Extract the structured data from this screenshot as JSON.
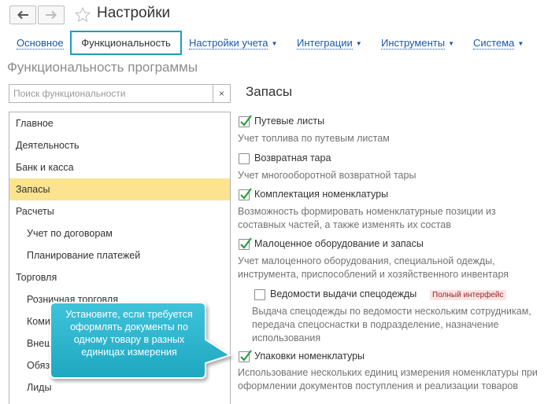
{
  "window": {
    "title": "Настройки"
  },
  "tabs": [
    {
      "label": "Основное",
      "dropdown": false
    },
    {
      "label": "Функциональность",
      "dropdown": false
    },
    {
      "label": "Настройки учета",
      "dropdown": true
    },
    {
      "label": "Интеграции",
      "dropdown": true
    },
    {
      "label": "Инструменты",
      "dropdown": true
    },
    {
      "label": "Система",
      "dropdown": true
    }
  ],
  "section_title": "Функциональность программы",
  "search": {
    "placeholder": "Поиск функциональности",
    "clear_icon": "×"
  },
  "left_list": [
    {
      "label": "Главное",
      "level": 0
    },
    {
      "label": "Деятельность",
      "level": 0
    },
    {
      "label": "Банк и касса",
      "level": 0
    },
    {
      "label": "Запасы",
      "level": 0,
      "selected": true
    },
    {
      "label": "Расчеты",
      "level": 0
    },
    {
      "label": "Учет по договорам",
      "level": 1
    },
    {
      "label": "Планирование платежей",
      "level": 1
    },
    {
      "label": "Торговля",
      "level": 0
    },
    {
      "label": "Розничная торговля",
      "level": 1
    },
    {
      "label": "Комис",
      "level": 1
    },
    {
      "label": "Внеш",
      "level": 1
    },
    {
      "label": "Обяза",
      "level": 1
    },
    {
      "label": "Лиды",
      "level": 1
    }
  ],
  "right_panel": {
    "title": "Запасы",
    "options": [
      {
        "label": "Путевые листы",
        "checked": true,
        "description": "Учет топлива по путевым листам"
      },
      {
        "label": "Возвратная тара",
        "checked": false,
        "description": "Учет многооборотной возвратной тары"
      },
      {
        "label": "Комплектация номенклатуры",
        "checked": true,
        "description": "Возможность формировать номенклатурные позиции из составных частей, а также изменять их состав"
      },
      {
        "label": "Малоценное оборудование и запасы",
        "checked": true,
        "description": "Учет малоценного оборудования, специальной одежды, инструмента, приспособлений и хозяйственного инвентаря"
      },
      {
        "label": "Ведомости выдачи спецодежды",
        "checked": false,
        "badge": "Полный интерфейс",
        "description": "Выдача спецодежды по ведомости нескольким сотрудникам, передача спецоснастки в подразделение, назначение использования"
      },
      {
        "label": "Упаковки номенклатуры",
        "checked": true,
        "description": "Использование нескольких единиц измерения номенклатуры при оформлении документов поступления и реализации товаров"
      }
    ]
  },
  "callout": {
    "text": "Установите, если требуется оформлять документы по одному товару в разных единицах измерения"
  },
  "colors": {
    "link": "#1d58a6",
    "accent_border": "#19a0b8",
    "selected_row": "#fbe38f",
    "check": "#2a9d3c",
    "callout_fill": "#29b6cf",
    "badge_text": "#9a1f1f"
  },
  "icons": {
    "back": "arrow-left-icon",
    "forward": "arrow-right-icon",
    "favorite": "star-icon",
    "checkmark": "check-icon",
    "dropdown": "triangle-down-icon"
  }
}
